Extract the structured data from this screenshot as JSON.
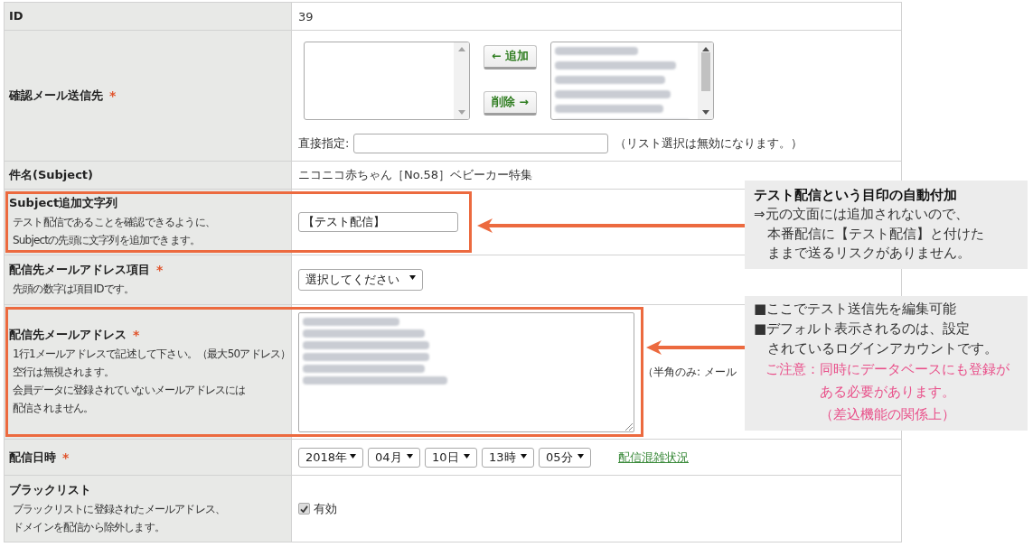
{
  "form": {
    "rows": [
      {
        "kind": "text",
        "label": "ID",
        "value": "39"
      },
      {
        "kind": "recipients",
        "label": "確認メール送信先",
        "required_mark": "*",
        "add_button": "← 追加",
        "remove_button": "削除 →",
        "direct_label": "直接指定:",
        "direct_note": "（リスト選択は無効になります。）"
      },
      {
        "kind": "text",
        "label": "件名(Subject)",
        "value": "ニコニコ赤ちゃん［No.58］ベビーカー特集"
      },
      {
        "kind": "input",
        "label": "Subject追加文字列",
        "description": [
          "テスト配信であることを確認できるように、",
          "Subjectの先頭に文字列を追加できます。"
        ],
        "value": "【テスト配信】",
        "annotation": {
          "paragraphs": [
            {
              "kind": "title",
              "lines": [
                "テスト配信という目印の自動付加"
              ]
            },
            {
              "kind": "item",
              "lines": [
                "⇒元の文面には追加されないので、",
                "本番配信に【テスト配信】と付けた",
                "ままで送るリスクがありません。"
              ]
            }
          ]
        }
      },
      {
        "kind": "select",
        "label": "配信先メールアドレス項目",
        "required_mark": "*",
        "description": [
          "先頭の数字は項目IDです。"
        ],
        "value": "選択してください"
      },
      {
        "kind": "textarea",
        "label": "配信先メールアドレス",
        "required_mark": "*",
        "description": [
          "1行1メールアドレスで記述して下さい。（最大50アドレス）",
          "空行は無視されます。",
          "会員データに登録されていないメールアドレスには",
          "配信されません。"
        ],
        "note": "（半角のみ: メール",
        "annotation": {
          "paragraphs": [
            {
              "kind": "item",
              "lines": [
                "■ここでテスト送信先を編集可能"
              ]
            },
            {
              "kind": "item",
              "lines": [
                "■デフォルト表示されるのは、設定",
                "されているログインアカウントです。"
              ]
            },
            {
              "kind": "warning",
              "lines": [
                "ご注意：同時にデータベースにも登録が",
                "ある必要があります。",
                "（差込機能の関係上）"
              ]
            }
          ]
        }
      },
      {
        "kind": "datetime",
        "label": "配信日時",
        "required_mark": "*",
        "selects": [
          "2018年",
          "04月",
          "10日",
          "13時",
          "05分"
        ],
        "link": "配信混雑状況"
      },
      {
        "kind": "checkbox",
        "label": "ブラックリスト",
        "description": [
          "ブラックリストに登録されたメールアドレス、",
          "ドメインを配信から除外します。"
        ],
        "checkbox": {
          "label": "有効",
          "checked": true
        }
      }
    ]
  }
}
